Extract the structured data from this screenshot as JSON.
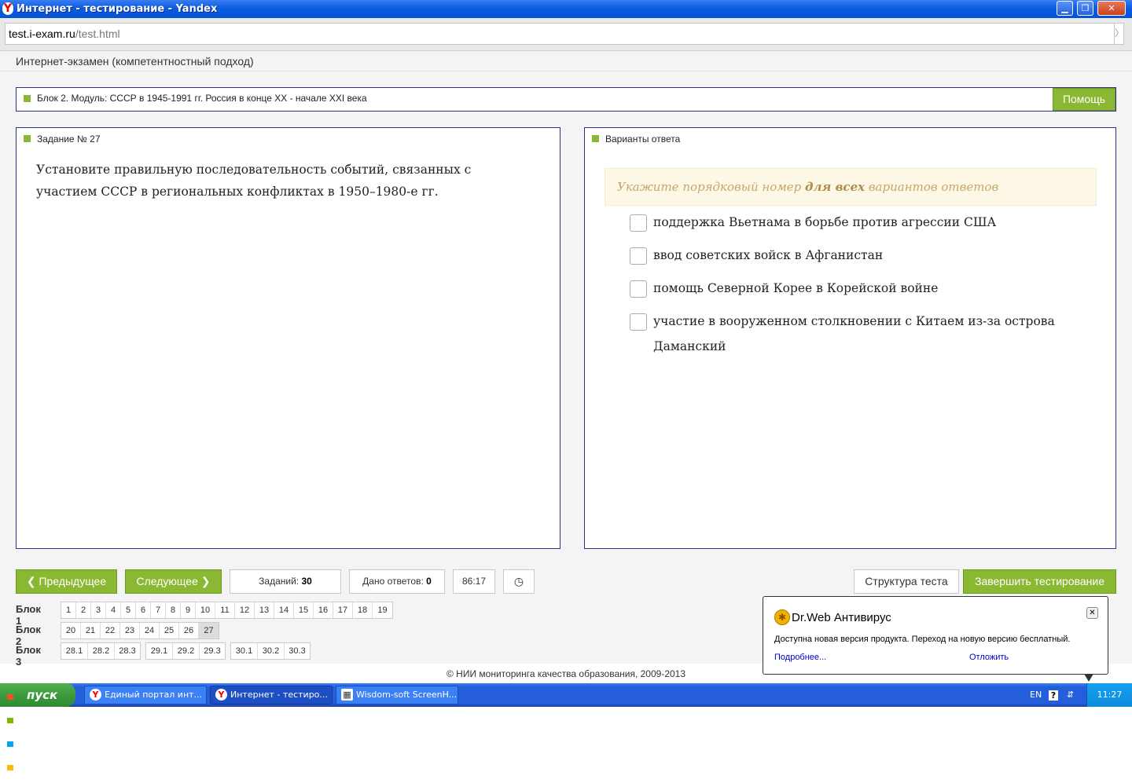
{
  "window": {
    "title": "Интернет - тестирование - Yandex"
  },
  "address": {
    "host": "test.i-exam.ru",
    "path": "/test.html"
  },
  "exam": {
    "title": "Интернет-экзамен (компетентностный подход)"
  },
  "block_bar": {
    "text": "Блок 2. Модуль: СССР в 1945-1991 гг. Россия в конце XX - начале XXI века",
    "help": "Помощь"
  },
  "question": {
    "header": "Задание № 27",
    "text": "Установите правильную последовательность событий, связанных с участием СССР в региональных конфликтах в 1950–1980-е гг."
  },
  "answers": {
    "header": "Варианты ответа",
    "hint_pre": "Укажите порядковый номер ",
    "hint_bold": "для всех",
    "hint_post": " вариантов ответов",
    "options": [
      "поддержка Вьетнама в борьбе против агрессии США",
      "ввод советских войск в Афганистан",
      "помощь Северной Корее в Корейской войне",
      "участие в вооруженном столкновении с Китаем из-за острова Даманский"
    ]
  },
  "nav": {
    "prev": "Предыдущее",
    "next": "Следующее",
    "tasks_label": "Заданий:",
    "tasks_value": "30",
    "answered_label": "Дано ответов:",
    "answered_value": "0",
    "timer": "86:17",
    "structure": "Структура теста",
    "finish": "Завершить тестирование"
  },
  "blocks": {
    "b1": {
      "label": "Блок 1",
      "items": [
        "1",
        "2",
        "3",
        "4",
        "5",
        "6",
        "7",
        "8",
        "9",
        "10",
        "11",
        "12",
        "13",
        "14",
        "15",
        "16",
        "17",
        "18",
        "19"
      ]
    },
    "b2": {
      "label": "Блок 2",
      "items": [
        "20",
        "21",
        "22",
        "23",
        "24",
        "25",
        "26",
        "27"
      ],
      "current": "27"
    },
    "b3": {
      "label": "Блок 3",
      "groups": [
        [
          "28.1",
          "28.2",
          "28.3"
        ],
        [
          "29.1",
          "29.2",
          "29.3"
        ],
        [
          "30.1",
          "30.2",
          "30.3"
        ]
      ]
    }
  },
  "footer": "© НИИ мониторинга качества образования, 2009-2013",
  "drweb": {
    "title": "Dr.Web Антивирус",
    "message": "Доступна новая версия продукта. Переход на новую версию бесплатный.",
    "more": "Подробнее...",
    "later": "Отложить"
  },
  "taskbar": {
    "start": "пуск",
    "tasks": [
      "Единый портал инт...",
      "Интернет - тестиро...",
      "Wisdom-soft ScreenH..."
    ],
    "lang": "EN",
    "clock": "11:27"
  },
  "colors": {
    "accent_green": "#8bb832",
    "panel_border": "#2e2e8c",
    "hint_bg": "#fcf8e5"
  }
}
